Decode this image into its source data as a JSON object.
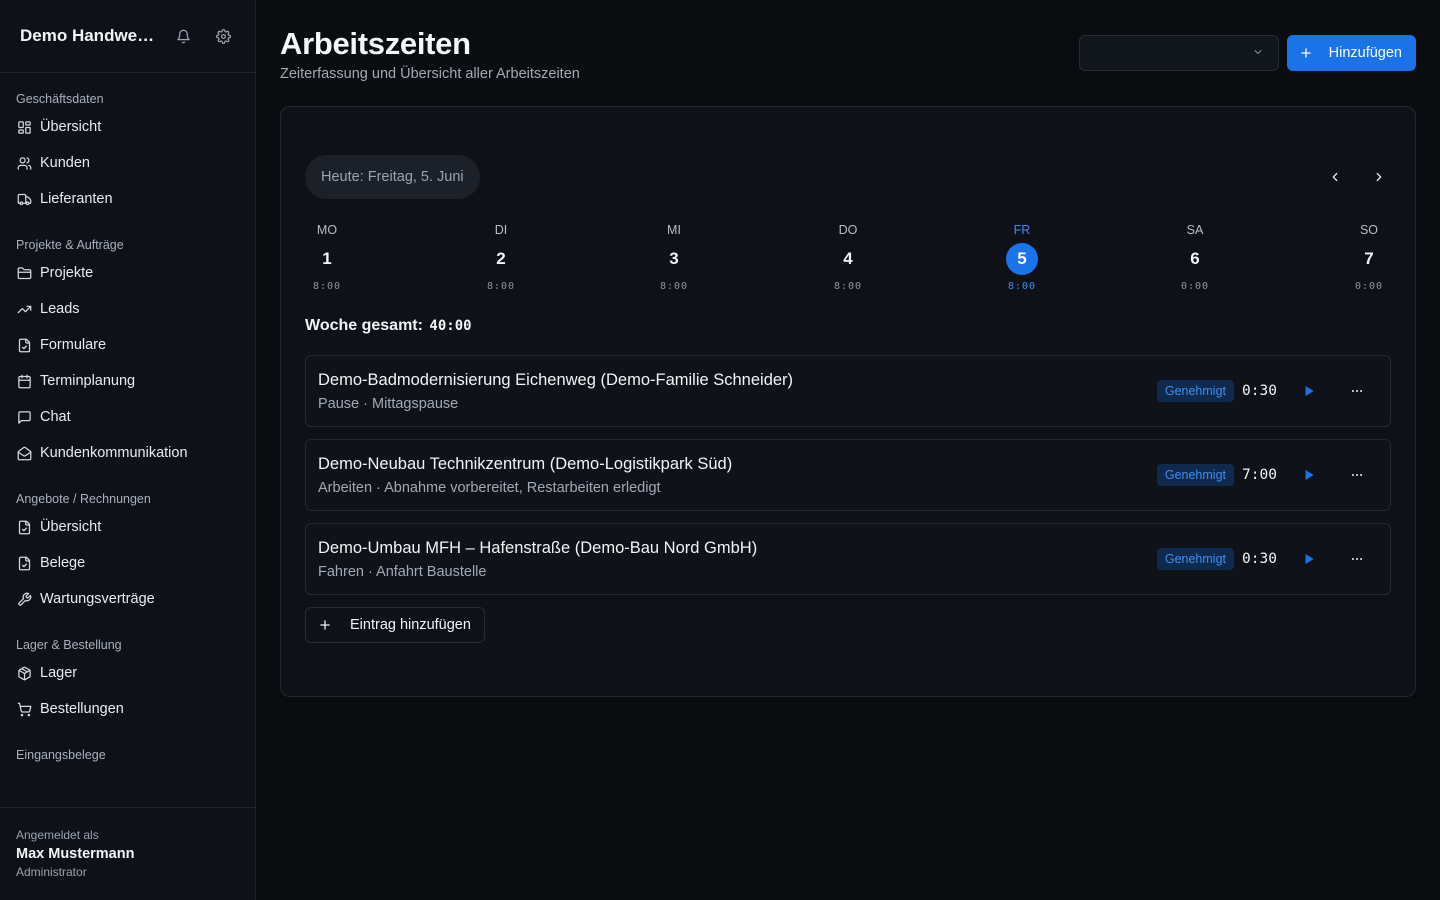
{
  "sidebar": {
    "title": "Demo Handwerk GmbH",
    "groups": [
      {
        "label": "Geschäftsdaten",
        "items": [
          {
            "label": "Übersicht",
            "icon": "dashboard-icon"
          },
          {
            "label": "Kunden",
            "icon": "users-icon"
          },
          {
            "label": "Lieferanten",
            "icon": "truck-icon"
          }
        ]
      },
      {
        "label": "Projekte & Aufträge",
        "items": [
          {
            "label": "Projekte",
            "icon": "folder-icon"
          },
          {
            "label": "Leads",
            "icon": "trending-up-icon"
          },
          {
            "label": "Formulare",
            "icon": "file-icon"
          },
          {
            "label": "Terminplanung",
            "icon": "calendar-icon"
          },
          {
            "label": "Chat",
            "icon": "chat-icon"
          },
          {
            "label": "Kundenkommunikation",
            "icon": "mail-open-icon"
          }
        ]
      },
      {
        "label": "Angebote / Rechnungen",
        "items": [
          {
            "label": "Übersicht",
            "icon": "file-icon"
          },
          {
            "label": "Belege",
            "icon": "file-icon"
          },
          {
            "label": "Wartungsverträge",
            "icon": "wrench-icon"
          }
        ]
      },
      {
        "label": "Lager & Bestellung",
        "items": [
          {
            "label": "Lager",
            "icon": "package-icon"
          },
          {
            "label": "Bestellungen",
            "icon": "cart-icon"
          }
        ]
      },
      {
        "label": "Eingangsbelege",
        "items": []
      }
    ],
    "footer": {
      "logged_in_as": "Angemeldet als",
      "user_name": "Max Mustermann",
      "role": "Administrator"
    }
  },
  "header": {
    "title": "Arbeitszeiten",
    "subtitle": "Zeiterfassung und Übersicht aller Arbeitszeiten",
    "select_value": "",
    "add_button": "Hinzufügen"
  },
  "calendar": {
    "today_label": "Heute: Freitag, 5. Juni",
    "days": [
      {
        "name": "MO",
        "date": "1",
        "hours": "8:00",
        "active": false
      },
      {
        "name": "DI",
        "date": "2",
        "hours": "8:00",
        "active": false
      },
      {
        "name": "MI",
        "date": "3",
        "hours": "8:00",
        "active": false
      },
      {
        "name": "DO",
        "date": "4",
        "hours": "8:00",
        "active": false
      },
      {
        "name": "FR",
        "date": "5",
        "hours": "8:00",
        "active": true
      },
      {
        "name": "SA",
        "date": "6",
        "hours": "0:00",
        "active": false
      },
      {
        "name": "SO",
        "date": "7",
        "hours": "0:00",
        "active": false
      }
    ],
    "week_total_label": "Woche gesamt:",
    "week_total_value": "40:00"
  },
  "entries": [
    {
      "title": "Demo-Badmodernisierung Eichenweg (Demo-Familie Schneider)",
      "detail": "Pause · Mittagspause",
      "status": "Genehmigt",
      "duration": "0:30"
    },
    {
      "title": "Demo-Neubau Technikzentrum (Demo-Logistikpark Süd)",
      "detail": "Arbeiten · Abnahme vorbereitet, Restarbeiten erledigt",
      "status": "Genehmigt",
      "duration": "7:00"
    },
    {
      "title": "Demo-Umbau MFH – Hafenstraße (Demo-Bau Nord GmbH)",
      "detail": "Fahren · Anfahrt Baustelle",
      "status": "Genehmigt",
      "duration": "0:30"
    }
  ],
  "add_entry_label": "Eintrag hinzufügen",
  "colors": {
    "accent": "#1a73e8",
    "badge_bg": "#0f2a4d",
    "badge_text": "#3b8ef0",
    "background": "#0a0c10"
  }
}
